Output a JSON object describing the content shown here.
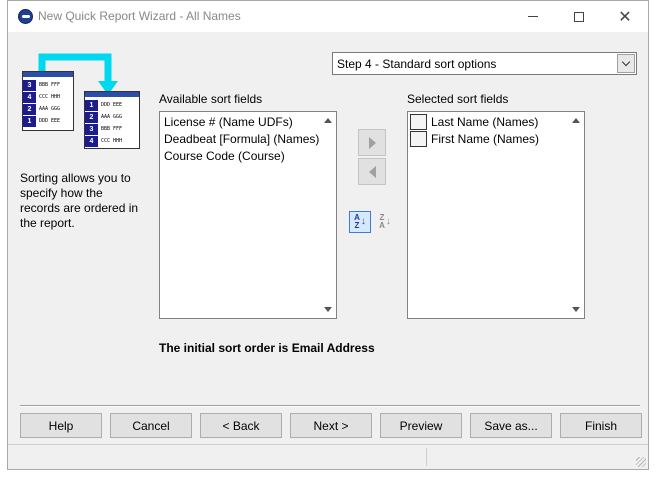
{
  "window": {
    "title": "New Quick Report Wizard - All Names"
  },
  "step_select": {
    "value": "Step 4 - Standard sort options"
  },
  "illustration": {
    "before_rows": [
      {
        "num": "3",
        "text": "BBB FFF"
      },
      {
        "num": "4",
        "text": "CCC HHH"
      },
      {
        "num": "2",
        "text": "AAA GGG"
      },
      {
        "num": "1",
        "text": "DDD EEE"
      }
    ],
    "after_rows": [
      {
        "num": "1",
        "text": "DDD EEE"
      },
      {
        "num": "2",
        "text": "AAA GGG"
      },
      {
        "num": "3",
        "text": "BBB FFF"
      },
      {
        "num": "4",
        "text": "CCC HHH"
      }
    ]
  },
  "help_text": "Sorting allows you to specify how the records are ordered in the report.",
  "available": {
    "label": "Available sort fields",
    "items": [
      "License # (Name UDFs)",
      "Deadbeat [Formula] (Names)",
      "Course Code (Course)"
    ]
  },
  "selected": {
    "label": "Selected sort fields",
    "items": [
      "Last Name (Names)",
      "First Name (Names)"
    ]
  },
  "sort_icons": {
    "az": {
      "top": "A",
      "bottom": "Z"
    },
    "za": {
      "top": "Z",
      "bottom": "A"
    }
  },
  "sort_note": "The initial sort order is Email Address",
  "buttons": {
    "help": "Help",
    "cancel": "Cancel",
    "back": "< Back",
    "next": "Next >",
    "preview": "Preview",
    "save_as": "Save as...",
    "finish": "Finish"
  },
  "colors": {
    "accent": "#2b4fa8",
    "arrow": "#00d8f0"
  }
}
